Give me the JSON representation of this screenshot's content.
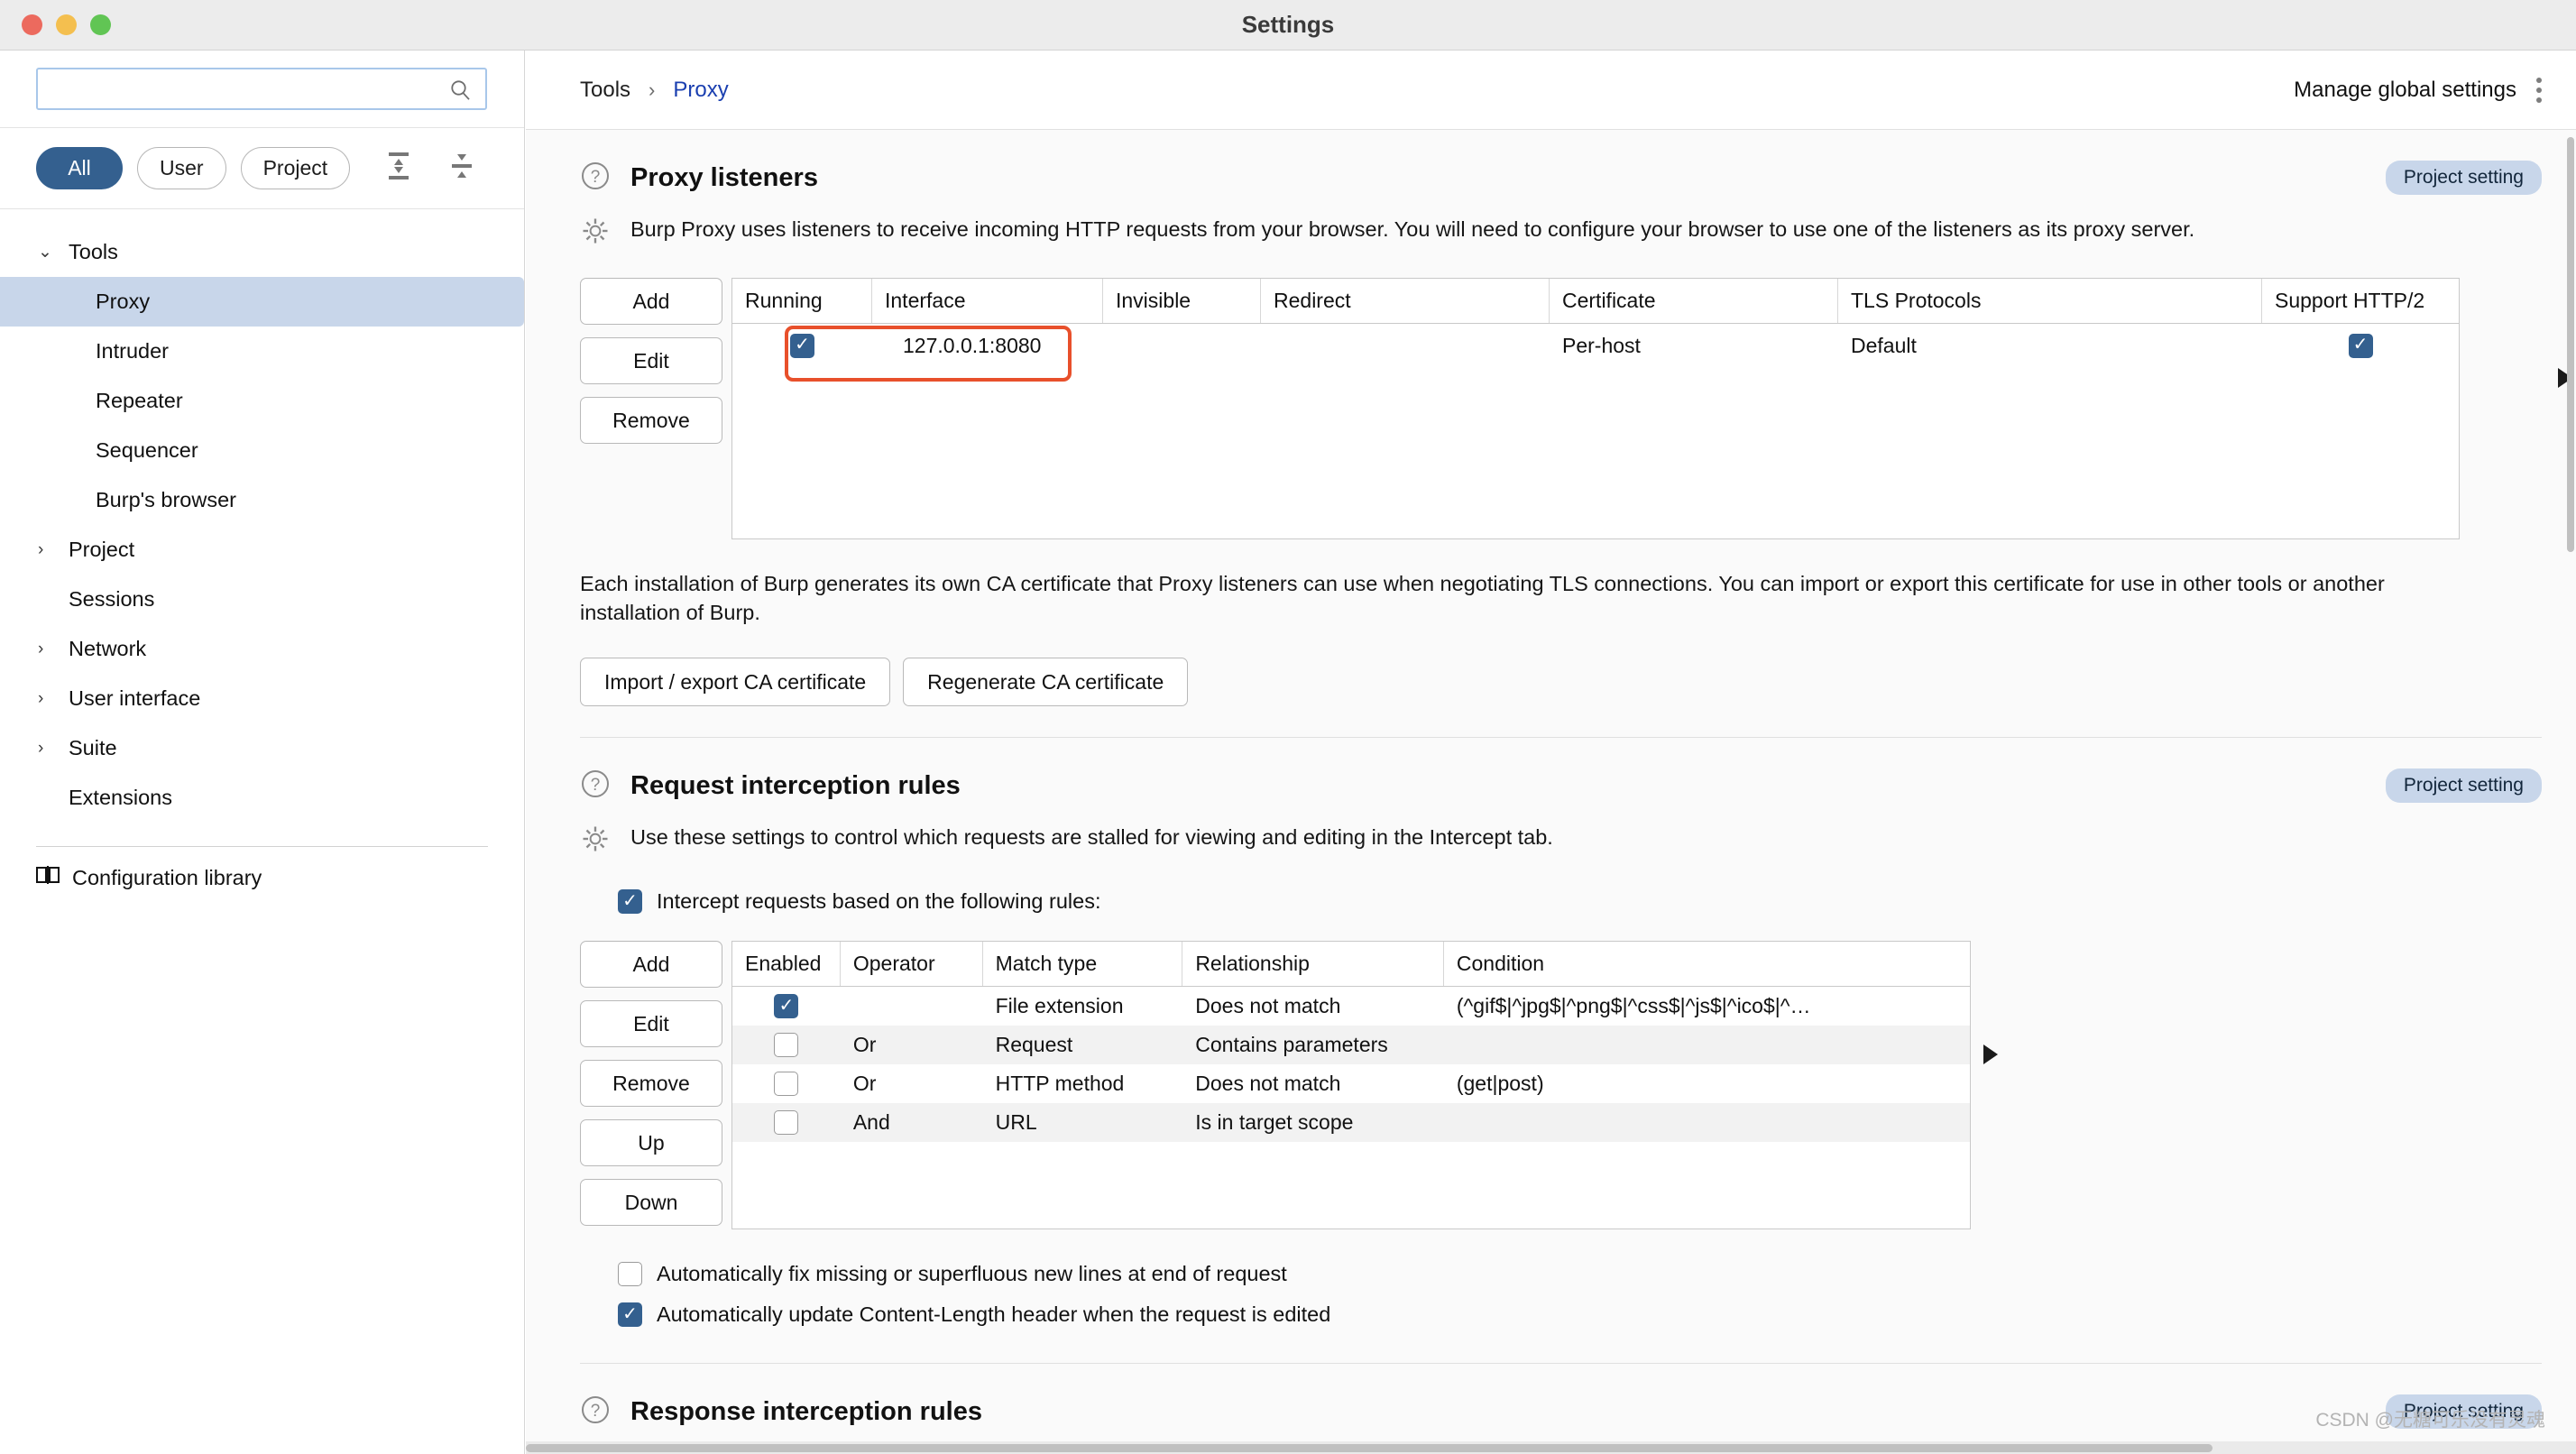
{
  "window": {
    "title": "Settings",
    "traffic_lights": [
      "close-red",
      "minimize-yellow",
      "maximize-green"
    ]
  },
  "sidebar": {
    "search": {
      "value": "",
      "placeholder": "",
      "icon": "search-icon"
    },
    "filters": [
      {
        "label": "All",
        "active": true
      },
      {
        "label": "User",
        "active": false
      },
      {
        "label": "Project",
        "active": false
      }
    ],
    "tool_icons": [
      "expand-all-icon",
      "collapse-all-icon"
    ],
    "tree": [
      {
        "label": "Tools",
        "type": "group",
        "chevron": "⌄",
        "expanded": true,
        "selected": false
      },
      {
        "label": "Proxy",
        "type": "leaf",
        "chevron": "",
        "selected": true
      },
      {
        "label": "Intruder",
        "type": "leaf",
        "chevron": "",
        "selected": false
      },
      {
        "label": "Repeater",
        "type": "leaf",
        "chevron": "",
        "selected": false
      },
      {
        "label": "Sequencer",
        "type": "leaf",
        "chevron": "",
        "selected": false
      },
      {
        "label": "Burp's browser",
        "type": "leaf",
        "chevron": "",
        "selected": false
      },
      {
        "label": "Project",
        "type": "group",
        "chevron": "›",
        "expanded": false,
        "selected": false
      },
      {
        "label": "Sessions",
        "type": "group-noarrow",
        "chevron": "",
        "selected": false
      },
      {
        "label": "Network",
        "type": "group",
        "chevron": "›",
        "expanded": false,
        "selected": false
      },
      {
        "label": "User interface",
        "type": "group",
        "chevron": "›",
        "expanded": false,
        "selected": false
      },
      {
        "label": "Suite",
        "type": "group",
        "chevron": "›",
        "expanded": false,
        "selected": false
      },
      {
        "label": "Extensions",
        "type": "group-noarrow",
        "chevron": "",
        "selected": false
      }
    ],
    "config_library": {
      "label": "Configuration library",
      "icon": "book-icon"
    }
  },
  "header": {
    "breadcrumb_root": "Tools",
    "breadcrumb_sep": "›",
    "breadcrumb_current": "Proxy",
    "manage_global_settings": "Manage global settings",
    "kebab": "more-options-icon"
  },
  "proxy_listeners": {
    "title": "Proxy listeners",
    "badge": "Project setting",
    "description": "Burp Proxy uses listeners to receive incoming HTTP requests from your browser. You will need to configure your browser to use one of the listeners as its proxy server.",
    "buttons": [
      "Add",
      "Edit",
      "Remove"
    ],
    "columns": [
      "Running",
      "Interface",
      "Invisible",
      "Redirect",
      "Certificate",
      "TLS Protocols",
      "Support HTTP/2"
    ],
    "rows": [
      {
        "running": true,
        "interface": "127.0.0.1:8080",
        "invisible": "",
        "redirect": "",
        "certificate": "Per-host",
        "tls_protocols": "Default",
        "support_http2": true
      }
    ],
    "ca_text": "Each installation of Burp generates its own CA certificate that Proxy listeners can use when negotiating TLS connections. You can import or export this certificate for use in other tools or another installation of Burp.",
    "ca_buttons": [
      "Import / export CA certificate",
      "Regenerate CA certificate"
    ]
  },
  "request_interception": {
    "title": "Request interception rules",
    "badge": "Project setting",
    "description": "Use these settings to control which requests are stalled for viewing and editing in the Intercept tab.",
    "intercept_checkbox": {
      "label": "Intercept requests based on the following rules:",
      "checked": true
    },
    "buttons": [
      "Add",
      "Edit",
      "Remove",
      "Up",
      "Down"
    ],
    "columns": [
      "Enabled",
      "Operator",
      "Match type",
      "Relationship",
      "Condition"
    ],
    "rows": [
      {
        "enabled": true,
        "operator": "",
        "match_type": "File extension",
        "relationship": "Does not match",
        "condition": "(^gif$|^jpg$|^png$|^css$|^js$|^ico$|^…"
      },
      {
        "enabled": false,
        "operator": "Or",
        "match_type": "Request",
        "relationship": "Contains parameters",
        "condition": ""
      },
      {
        "enabled": false,
        "operator": "Or",
        "match_type": "HTTP method",
        "relationship": "Does not match",
        "condition": "(get|post)"
      },
      {
        "enabled": false,
        "operator": "And",
        "match_type": "URL",
        "relationship": "Is in target scope",
        "condition": ""
      }
    ],
    "options": [
      {
        "label": "Automatically fix missing or superfluous new lines at end of request",
        "checked": false
      },
      {
        "label": "Automatically update Content-Length header when the request is edited",
        "checked": true
      }
    ]
  },
  "response_interception": {
    "title": "Response interception rules",
    "badge": "Project setting"
  },
  "watermark": "CSDN @无糖可乐没有灵魂",
  "colors": {
    "accent": "#34608f",
    "selection": "#c8d6ea",
    "link": "#1a3fb0",
    "highlight": "#e8502b",
    "badge_bg": "#c8d6ea"
  }
}
